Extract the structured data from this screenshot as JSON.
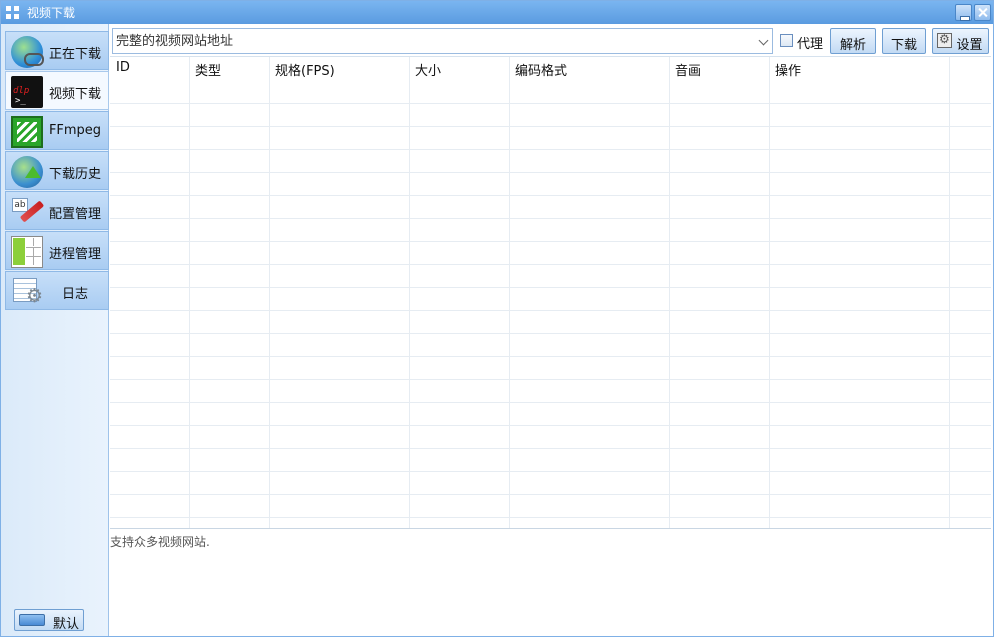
{
  "window": {
    "title": "视频下载",
    "accent": "#5a9be0"
  },
  "sidebar": {
    "items": [
      {
        "label": "正在下载",
        "icon": "globe-chain-icon"
      },
      {
        "label": "视频下载",
        "icon": "yt-dlp-icon"
      },
      {
        "label": "FFmpeg",
        "icon": "ffmpeg-icon"
      },
      {
        "label": "下载历史",
        "icon": "globe-upload-icon"
      },
      {
        "label": "配置管理",
        "icon": "edit-text-icon"
      },
      {
        "label": "进程管理",
        "icon": "process-grid-icon"
      },
      {
        "label": "日志",
        "icon": "log-settings-icon"
      }
    ],
    "active_index": 1,
    "theme_button": "默认",
    "dlp_icon_text_a": ">_",
    "dlp_icon_text_b": "dlp",
    "config_icon_text": "ab"
  },
  "toolbar": {
    "url_placeholder": "完整的视频网站地址",
    "proxy_label": "代理",
    "proxy_checked": false,
    "parse_label": "解析",
    "download_label": "下载",
    "settings_label": "设置"
  },
  "grid": {
    "columns": [
      "ID",
      "类型",
      "规格(FPS)",
      "大小",
      "编码格式",
      "音画",
      "操作"
    ],
    "rows": []
  },
  "status_text": "支持众多视频网站."
}
